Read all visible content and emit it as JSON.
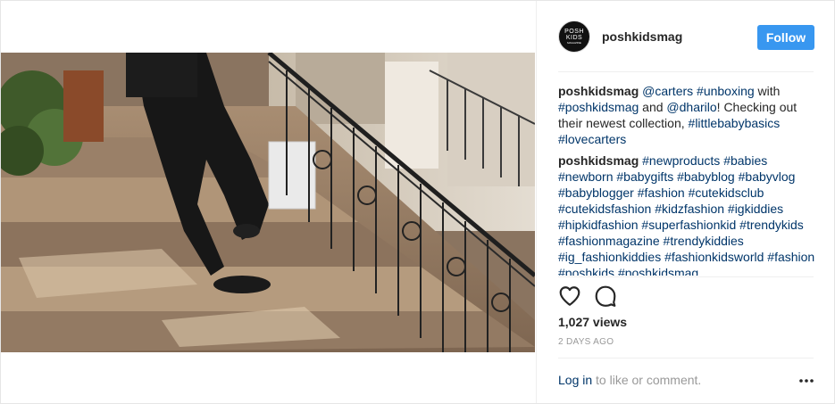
{
  "post": {
    "username": "poshkidsmag",
    "follow_label": "Follow",
    "avatar_lines": [
      "POSH",
      "KIDS",
      "MAGAZINE"
    ],
    "comments": [
      {
        "user": "poshkidsmag",
        "tokens": [
          {
            "t": "@carters",
            "tag": true
          },
          {
            "t": " ",
            "tag": false
          },
          {
            "t": "#unboxing",
            "tag": true
          },
          {
            "t": " with ",
            "tag": false
          },
          {
            "t": "#poshkidsmag",
            "tag": true
          },
          {
            "t": " and ",
            "tag": false
          },
          {
            "t": "@dharilo",
            "tag": true
          },
          {
            "t": "! Checking out their newest collection, ",
            "tag": false
          },
          {
            "t": "#littlebabybasics",
            "tag": true
          },
          {
            "t": " ",
            "tag": false
          },
          {
            "t": "#lovecarters",
            "tag": true
          }
        ]
      },
      {
        "user": "poshkidsmag",
        "tokens": [
          {
            "t": "#newproducts",
            "tag": true
          },
          {
            "t": " ",
            "tag": false
          },
          {
            "t": "#babies",
            "tag": true
          },
          {
            "t": " ",
            "tag": false
          },
          {
            "t": "#newborn",
            "tag": true
          },
          {
            "t": " ",
            "tag": false
          },
          {
            "t": "#babygifts",
            "tag": true
          },
          {
            "t": " ",
            "tag": false
          },
          {
            "t": "#babyblog",
            "tag": true
          },
          {
            "t": " ",
            "tag": false
          },
          {
            "t": "#babyvlog",
            "tag": true
          },
          {
            "t": " ",
            "tag": false
          },
          {
            "t": "#babyblogger",
            "tag": true
          },
          {
            "t": " ",
            "tag": false
          },
          {
            "t": "#fashion",
            "tag": true
          },
          {
            "t": " ",
            "tag": false
          },
          {
            "t": "#cutekidsclub",
            "tag": true
          },
          {
            "t": " ",
            "tag": false
          },
          {
            "t": "#cutekidsfashion",
            "tag": true
          },
          {
            "t": " ",
            "tag": false
          },
          {
            "t": "#kidzfashion",
            "tag": true
          },
          {
            "t": " ",
            "tag": false
          },
          {
            "t": "#igkiddies",
            "tag": true
          },
          {
            "t": " ",
            "tag": false
          },
          {
            "t": "#hipkidfashion",
            "tag": true
          },
          {
            "t": " ",
            "tag": false
          },
          {
            "t": "#superfashionkid",
            "tag": true
          },
          {
            "t": " ",
            "tag": false
          },
          {
            "t": "#trendykids",
            "tag": true
          },
          {
            "t": " ",
            "tag": false
          },
          {
            "t": "#fashionmagazine",
            "tag": true
          },
          {
            "t": " ",
            "tag": false
          },
          {
            "t": "#trendykiddies",
            "tag": true
          },
          {
            "t": " ",
            "tag": false
          },
          {
            "t": "#ig_fashionkiddies",
            "tag": true
          },
          {
            "t": " ",
            "tag": false
          },
          {
            "t": "#fashionkidsworld",
            "tag": true
          },
          {
            "t": " ",
            "tag": false
          },
          {
            "t": "#fashion",
            "tag": true
          },
          {
            "t": " ",
            "tag": false
          },
          {
            "t": "#poshkids",
            "tag": true
          },
          {
            "t": " ",
            "tag": false
          },
          {
            "t": "#poshkidsmag",
            "tag": true
          }
        ]
      }
    ],
    "views": "1,027 views",
    "timestamp": "2 DAYS AGO",
    "footer": {
      "login": "Log in",
      "rest": " to like or comment."
    },
    "icons": {
      "like": "heart-icon",
      "comment": "comment-icon",
      "more": "more-options-icon"
    },
    "colors": {
      "follow_bg": "#3897f0",
      "link": "#003569",
      "muted": "#999999"
    }
  }
}
